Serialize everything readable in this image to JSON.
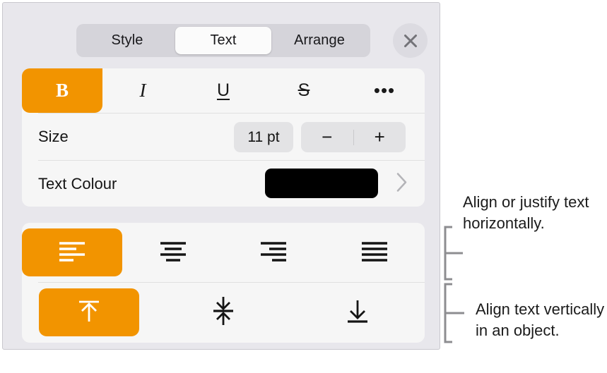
{
  "panel": {
    "tabs": [
      {
        "label": "Style",
        "active": false
      },
      {
        "label": "Text",
        "active": true
      },
      {
        "label": "Arrange",
        "active": false
      }
    ],
    "close_label": "Close"
  },
  "format_card": {
    "style_buttons": [
      {
        "name": "bold",
        "glyph": "B",
        "selected": true
      },
      {
        "name": "italic",
        "glyph": "I",
        "selected": false
      },
      {
        "name": "underline",
        "glyph": "U",
        "selected": false
      },
      {
        "name": "strikethrough",
        "glyph": "S",
        "selected": false
      },
      {
        "name": "more-options",
        "glyph": "•••",
        "selected": false
      }
    ],
    "size": {
      "label": "Size",
      "value": "11 pt",
      "decrease_label": "−",
      "separator": "",
      "increase_label": "+"
    },
    "text_colour": {
      "label": "Text Colour",
      "swatch_colour": "#000000",
      "disclosure": "›"
    }
  },
  "align_card": {
    "horizontal": [
      {
        "name": "align-left",
        "selected": true
      },
      {
        "name": "align-centre",
        "selected": false
      },
      {
        "name": "align-right",
        "selected": false
      },
      {
        "name": "align-justify",
        "selected": false
      }
    ],
    "vertical": [
      {
        "name": "align-top",
        "selected": true
      },
      {
        "name": "align-middle",
        "selected": false
      },
      {
        "name": "align-bottom",
        "selected": false
      }
    ]
  },
  "callouts": [
    {
      "text": "Align or justify text horizontally."
    },
    {
      "text": "Align text vertically in an object."
    }
  ],
  "colours": {
    "accent_orange": "#f29400",
    "panel_background": "#e8e7ec",
    "card_background": "#f6f6f6",
    "segmented_track": "#d5d4da",
    "segmented_active": "#fbfbfb"
  }
}
